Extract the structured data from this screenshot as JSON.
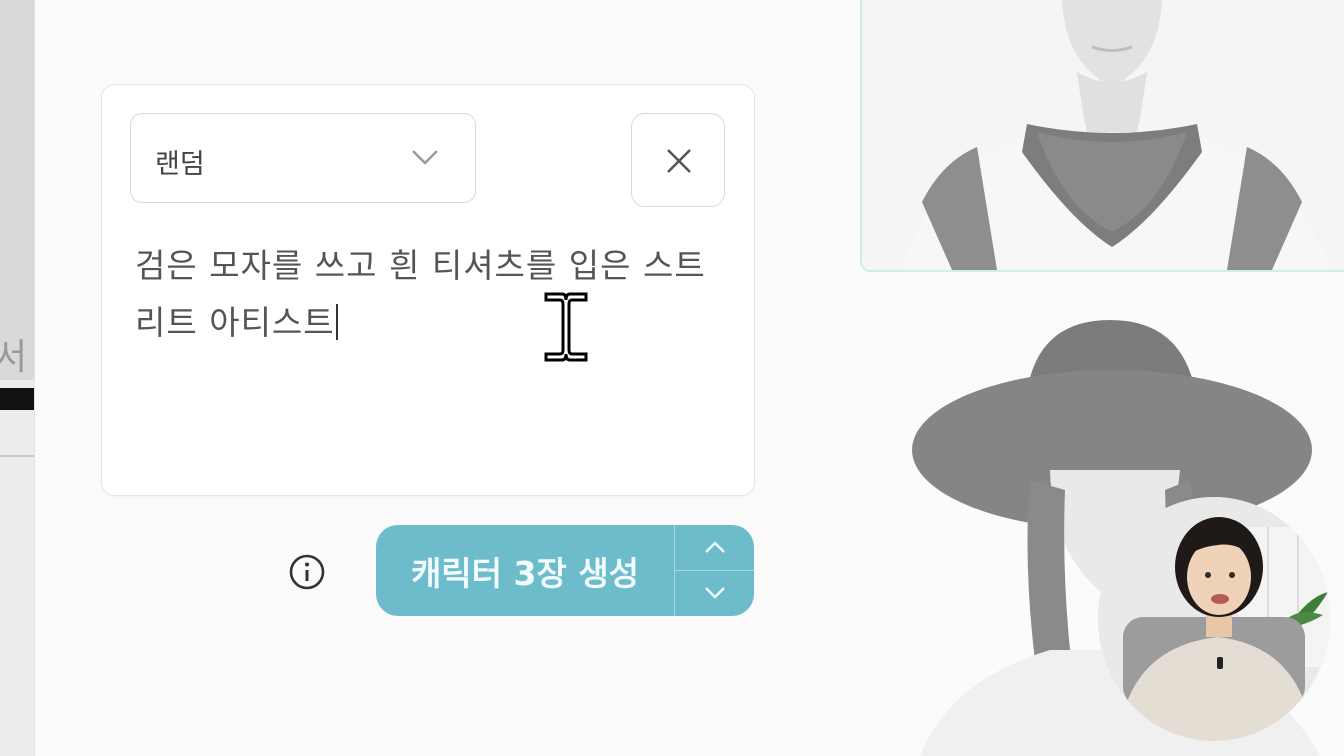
{
  "prompt_panel": {
    "style_select": {
      "value": "랜덤",
      "icon": "chevron-down-icon"
    },
    "close_icon": "close-icon",
    "prompt_text_line1": "검은 모자를 쓰고 흰 티셔츠를 입은 스트",
    "prompt_text_line2": "리트 아티스트"
  },
  "actions": {
    "info_icon": "info-icon",
    "generate_label": "캐릭터 3장 생성",
    "stepper_up_icon": "chevron-up-icon",
    "stepper_down_icon": "chevron-down-icon"
  },
  "colors": {
    "accent": "#6dbccb",
    "selected_border": "#d3ebee"
  },
  "edge_glyph": "서"
}
